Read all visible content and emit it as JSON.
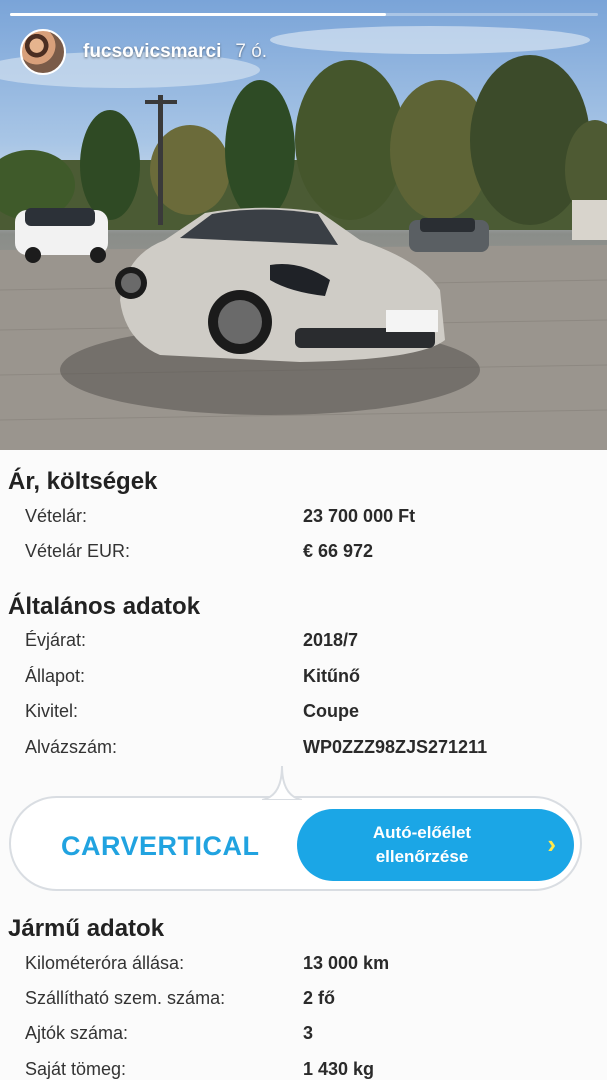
{
  "story": {
    "username": "fucsovicsmarci",
    "time": "7 ó.",
    "progress_percent": 64
  },
  "sections": {
    "price": {
      "title": "Ár, költségek",
      "rows": [
        {
          "label": "Vételár:",
          "value": "23 700 000 Ft"
        },
        {
          "label": "Vételár EUR:",
          "value": "€ 66 972"
        }
      ]
    },
    "general": {
      "title": "Általános adatok",
      "rows": [
        {
          "label": "Évjárat:",
          "value": "2018/7"
        },
        {
          "label": "Állapot:",
          "value": "Kitűnő"
        },
        {
          "label": "Kivitel:",
          "value": "Coupe"
        },
        {
          "label": "Alvázszám:",
          "value": "WP0ZZZ98ZJS271211"
        }
      ]
    },
    "vehicle": {
      "title": "Jármű adatok",
      "rows": [
        {
          "label": "Kilométeróra állása:",
          "value": "13 000 km"
        },
        {
          "label": "Szállítható szem. száma:",
          "value": "2 fő"
        },
        {
          "label": "Ajtók száma:",
          "value": "3"
        },
        {
          "label": "Saját tömeg:",
          "value": "1 430 kg"
        }
      ]
    }
  },
  "carvertical": {
    "logo": "CARVERTICAL",
    "button_label": "Autó-előélet ellenőrzése",
    "arrow_icon": "chevron-right-icon",
    "brand_color": "#1ba6e6",
    "arrow_color": "#ffe94d"
  }
}
